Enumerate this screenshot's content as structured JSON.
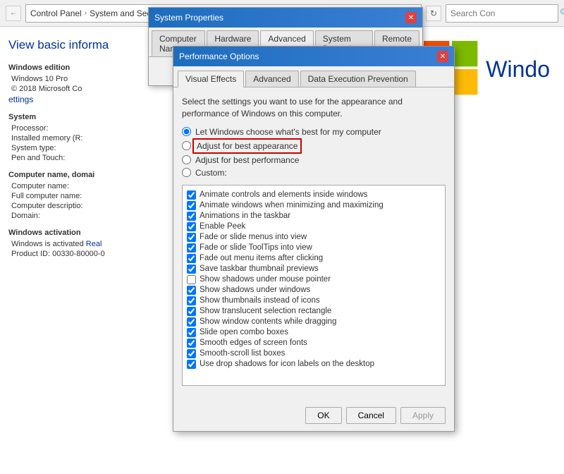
{
  "topbar": {
    "breadcrumb": {
      "part1": "Control Panel",
      "sep1": "›",
      "part2": "System and Security"
    },
    "search_placeholder": "Search Con"
  },
  "sidebar": {
    "page_title": "View basic informa",
    "sections": {
      "windows_edition": {
        "label": "Windows edition",
        "os_name": "Windows 10 Pro",
        "copyright": "© 2018 Microsoft Co"
      },
      "settings_link": "ettings",
      "system": {
        "label": "System",
        "rows": [
          {
            "key": "Processor:",
            "value": ""
          },
          {
            "key": "Installed memory (R:",
            "value": ""
          },
          {
            "key": "System type:",
            "value": ""
          },
          {
            "key": "Pen and Touch:",
            "value": ""
          }
        ]
      },
      "computer_name": {
        "label": "Computer name, domai",
        "rows": [
          {
            "key": "Computer name:",
            "value": ""
          },
          {
            "key": "Full computer name:",
            "value": ""
          },
          {
            "key": "Computer descriptio:",
            "value": ""
          },
          {
            "key": "Domain:",
            "value": ""
          }
        ]
      },
      "windows_activation": {
        "label": "Windows activation",
        "rows": [
          {
            "key": "Windows is activated",
            "value": "Real"
          },
          {
            "key": "Product ID: 00330-80000-0",
            "value": ""
          }
        ]
      }
    }
  },
  "windows_logo": {
    "text": "Windo"
  },
  "sysprops_dialog": {
    "title": "System Properties",
    "tabs": [
      {
        "label": "Computer Name",
        "active": false
      },
      {
        "label": "Hardware",
        "active": false
      },
      {
        "label": "Advanced",
        "active": true
      },
      {
        "label": "System Protection",
        "active": false
      },
      {
        "label": "Remote",
        "active": false
      }
    ]
  },
  "perf_dialog": {
    "title": "Performance Options",
    "tabs": [
      {
        "label": "Visual Effects",
        "active": true
      },
      {
        "label": "Advanced",
        "active": false
      },
      {
        "label": "Data Execution Prevention",
        "active": false
      }
    ],
    "description": "Select the settings you want to use for the appearance and performance of Windows on this computer.",
    "radio_options": [
      {
        "id": "r1",
        "label": "Let Windows choose what's best for my computer",
        "checked": true,
        "highlighted": false
      },
      {
        "id": "r2",
        "label": "Adjust for best appearance",
        "checked": false,
        "highlighted": true
      },
      {
        "id": "r3",
        "label": "Adjust for best performance",
        "checked": false,
        "highlighted": false
      },
      {
        "id": "r4",
        "label": "Custom:",
        "checked": false,
        "highlighted": false
      }
    ],
    "checkboxes": [
      {
        "label": "Animate controls and elements inside windows",
        "checked": true
      },
      {
        "label": "Animate windows when minimizing and maximizing",
        "checked": true
      },
      {
        "label": "Animations in the taskbar",
        "checked": true
      },
      {
        "label": "Enable Peek",
        "checked": true
      },
      {
        "label": "Fade or slide menus into view",
        "checked": true
      },
      {
        "label": "Fade or slide ToolTips into view",
        "checked": true
      },
      {
        "label": "Fade out menu items after clicking",
        "checked": true
      },
      {
        "label": "Save taskbar thumbnail previews",
        "checked": true
      },
      {
        "label": "Show shadows under mouse pointer",
        "checked": false
      },
      {
        "label": "Show shadows under windows",
        "checked": true
      },
      {
        "label": "Show thumbnails instead of icons",
        "checked": true
      },
      {
        "label": "Show translucent selection rectangle",
        "checked": true
      },
      {
        "label": "Show window contents while dragging",
        "checked": true
      },
      {
        "label": "Slide open combo boxes",
        "checked": true
      },
      {
        "label": "Smooth edges of screen fonts",
        "checked": true
      },
      {
        "label": "Smooth-scroll list boxes",
        "checked": true
      },
      {
        "label": "Use drop shadows for icon labels on the desktop",
        "checked": true
      }
    ],
    "buttons": {
      "ok": "OK",
      "cancel": "Cancel",
      "apply": "Apply"
    }
  }
}
